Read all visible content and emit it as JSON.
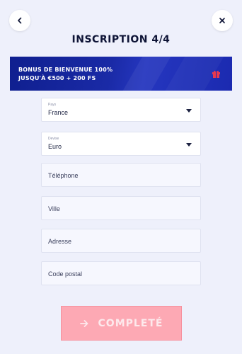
{
  "header": {
    "back_icon": "chevron-left-icon",
    "close_icon": "close-icon",
    "title": "INSCRIPTION 4/4"
  },
  "banner": {
    "line1": "BONUS DE BIENVENUE 100%",
    "line2": "JUSQU'À €500 + 200 FS",
    "icon": "gift-icon",
    "accent_color": "#e8394f"
  },
  "form": {
    "country": {
      "label": "Pays",
      "value": "France"
    },
    "currency": {
      "label": "Devise",
      "value": "Euro"
    },
    "phone": {
      "placeholder": "Téléphone"
    },
    "city": {
      "placeholder": "Ville"
    },
    "address": {
      "placeholder": "Adresse"
    },
    "postal_code": {
      "placeholder": "Code postal"
    }
  },
  "submit": {
    "label": "COMPLETÉ",
    "icon": "arrow-right-icon",
    "color": "#fda9b4"
  }
}
